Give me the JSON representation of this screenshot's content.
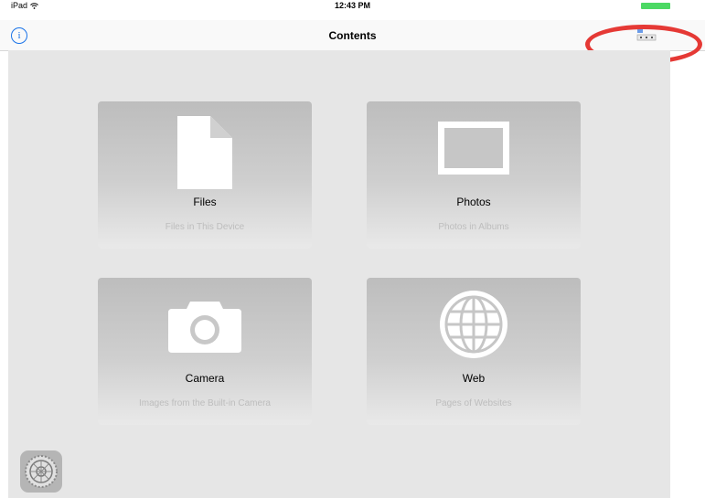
{
  "status_bar": {
    "device": "iPad",
    "time": "12:43 PM"
  },
  "nav": {
    "title": "Contents",
    "info_label": "i"
  },
  "cards": [
    {
      "title": "Files",
      "subtitle": "Files in This Device",
      "icon": "document-icon"
    },
    {
      "title": "Photos",
      "subtitle": "Photos in Albums",
      "icon": "photo-frame-icon"
    },
    {
      "title": "Camera",
      "subtitle": "Images from the Built-in Camera",
      "icon": "camera-icon"
    },
    {
      "title": "Web",
      "subtitle": "Pages of Websites",
      "icon": "globe-icon"
    }
  ],
  "colors": {
    "accent": "#1a73e8",
    "highlight": "#e53935",
    "battery": "#4cd964"
  }
}
